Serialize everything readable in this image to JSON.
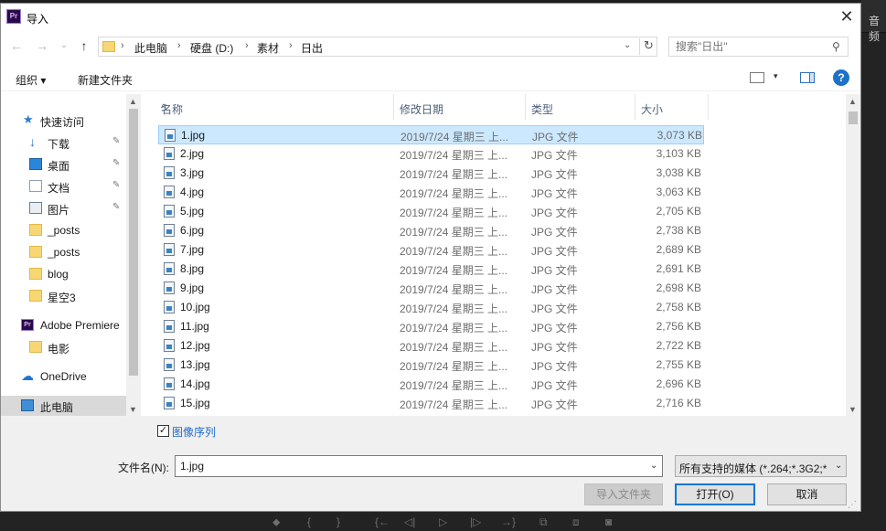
{
  "background": {
    "right_panel_label": "音频",
    "bottom_tools": [
      "⬥",
      "{",
      "}",
      "{←",
      "◁|",
      "▷",
      "|▷",
      "→}",
      "⧉",
      "⧈",
      "◙"
    ]
  },
  "dialog": {
    "app_icon_text": "Pr",
    "title": "导入",
    "close_label": "✕"
  },
  "nav": {
    "back": "←",
    "forward": "→",
    "recent": "⌄",
    "up": "↑",
    "breadcrumb": [
      "此电脑",
      "硬盘 (D:)",
      "素材",
      "日出"
    ],
    "breadcrumb_sep": "›",
    "dropdown": "⌄",
    "refresh": "↻",
    "search_placeholder": "搜索\"日出\"",
    "search_icon": "⚲"
  },
  "toolbar": {
    "organize": "组织 ▾",
    "new_folder": "新建文件夹",
    "view_dropdown": "▾",
    "help": "?"
  },
  "sidebar": {
    "items": [
      {
        "label": "快速访问",
        "icon": "star-icon"
      },
      {
        "label": "下载",
        "icon": "download-icon",
        "pinned": true
      },
      {
        "label": "桌面",
        "icon": "desktop-icon",
        "pinned": true
      },
      {
        "label": "文档",
        "icon": "document-icon",
        "pinned": true
      },
      {
        "label": "图片",
        "icon": "pictures-icon",
        "pinned": true
      },
      {
        "label": "_posts",
        "icon": "folder-icon"
      },
      {
        "label": "_posts",
        "icon": "folder-icon"
      },
      {
        "label": "blog",
        "icon": "folder-icon"
      },
      {
        "label": "星空3",
        "icon": "folder-icon"
      },
      {
        "label": "Adobe Premiere",
        "icon": "premiere-icon"
      },
      {
        "label": "电影",
        "icon": "folder-icon"
      },
      {
        "label": "OneDrive",
        "icon": "cloud-icon"
      },
      {
        "label": "此电脑",
        "icon": "computer-icon"
      }
    ],
    "pin_glyph": "📌"
  },
  "files": {
    "columns": [
      "名称",
      "修改日期",
      "类型",
      "大小"
    ],
    "sort_glyph": "^",
    "rows": [
      {
        "name": "1.jpg",
        "date": "2019/7/24 星期三 上...",
        "type": "JPG 文件",
        "size": "3,073 KB"
      },
      {
        "name": "2.jpg",
        "date": "2019/7/24 星期三 上...",
        "type": "JPG 文件",
        "size": "3,103 KB"
      },
      {
        "name": "3.jpg",
        "date": "2019/7/24 星期三 上...",
        "type": "JPG 文件",
        "size": "3,038 KB"
      },
      {
        "name": "4.jpg",
        "date": "2019/7/24 星期三 上...",
        "type": "JPG 文件",
        "size": "3,063 KB"
      },
      {
        "name": "5.jpg",
        "date": "2019/7/24 星期三 上...",
        "type": "JPG 文件",
        "size": "2,705 KB"
      },
      {
        "name": "6.jpg",
        "date": "2019/7/24 星期三 上...",
        "type": "JPG 文件",
        "size": "2,738 KB"
      },
      {
        "name": "7.jpg",
        "date": "2019/7/24 星期三 上...",
        "type": "JPG 文件",
        "size": "2,689 KB"
      },
      {
        "name": "8.jpg",
        "date": "2019/7/24 星期三 上...",
        "type": "JPG 文件",
        "size": "2,691 KB"
      },
      {
        "name": "9.jpg",
        "date": "2019/7/24 星期三 上...",
        "type": "JPG 文件",
        "size": "2,698 KB"
      },
      {
        "name": "10.jpg",
        "date": "2019/7/24 星期三 上...",
        "type": "JPG 文件",
        "size": "2,758 KB"
      },
      {
        "name": "11.jpg",
        "date": "2019/7/24 星期三 上...",
        "type": "JPG 文件",
        "size": "2,756 KB"
      },
      {
        "name": "12.jpg",
        "date": "2019/7/24 星期三 上...",
        "type": "JPG 文件",
        "size": "2,722 KB"
      },
      {
        "name": "13.jpg",
        "date": "2019/7/24 星期三 上...",
        "type": "JPG 文件",
        "size": "2,755 KB"
      },
      {
        "name": "14.jpg",
        "date": "2019/7/24 星期三 上...",
        "type": "JPG 文件",
        "size": "2,696 KB"
      },
      {
        "name": "15.jpg",
        "date": "2019/7/24 星期三 上...",
        "type": "JPG 文件",
        "size": "2,716 KB"
      }
    ]
  },
  "footer": {
    "image_sequence_label": "图像序列",
    "image_sequence_checked": true,
    "check_glyph": "✓",
    "filename_label": "文件名(N):",
    "filename_value": "1.jpg",
    "filter_value": "所有支持的媒体 (*.264;*.3G2;*",
    "dropdown": "⌄",
    "import_folder_label": "导入文件夹",
    "open_label": "打开(O)",
    "cancel_label": "取消",
    "grip": "⋰"
  },
  "colors": {
    "selection": "#cce8ff",
    "link_blue": "#1e6bc8",
    "primary_border": "#0078d7"
  }
}
